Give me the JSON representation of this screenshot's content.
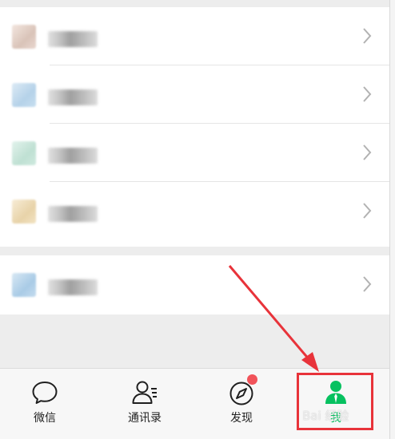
{
  "menu_groups": [
    {
      "items": [
        {
          "icon": "blurred-icon-1",
          "icon_color": "#e9d7cf"
        },
        {
          "icon": "blurred-icon-2",
          "icon_color": "#c7dff0"
        },
        {
          "icon": "blurred-icon-3",
          "icon_color": "#cfeadf"
        },
        {
          "icon": "blurred-icon-4",
          "icon_color": "#f2e3c2"
        }
      ]
    },
    {
      "items": [
        {
          "icon": "blurred-icon-5",
          "icon_color": "#c4dcef"
        }
      ]
    }
  ],
  "tabbar": {
    "tabs": [
      {
        "label": "微信",
        "icon": "chat-bubble-icon"
      },
      {
        "label": "通讯录",
        "icon": "contacts-icon"
      },
      {
        "label": "发现",
        "icon": "compass-icon",
        "has_badge": true
      },
      {
        "label": "我",
        "icon": "person-icon",
        "active": true
      }
    ]
  },
  "colors": {
    "accent": "#07c160",
    "badge": "#f1535a",
    "annotation": "#e8333a"
  },
  "watermark": "Bai 经验"
}
